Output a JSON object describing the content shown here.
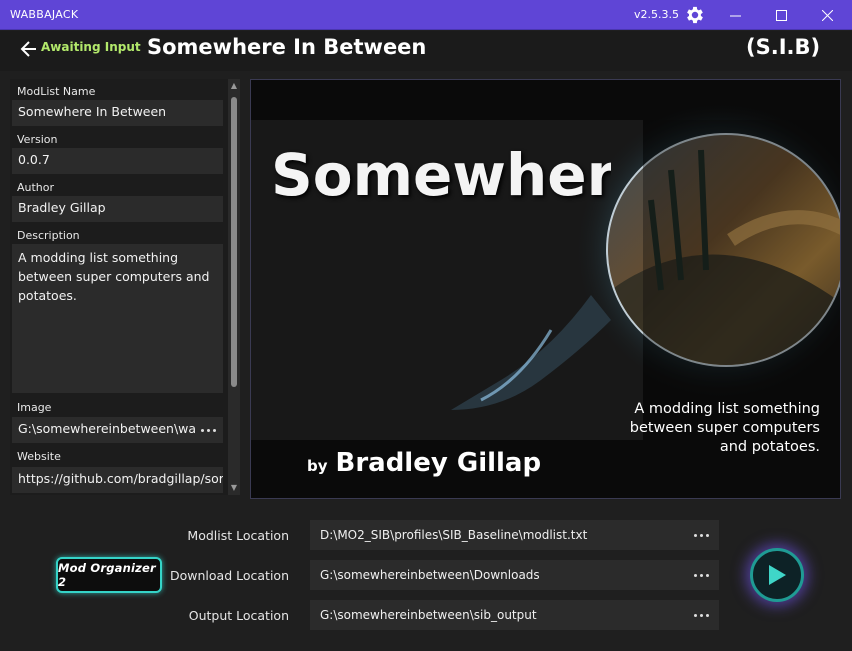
{
  "app": {
    "title": "WABBAJACK",
    "version": "v2.5.3.5"
  },
  "header": {
    "status": "Awaiting Input",
    "title": "Somewhere In Between",
    "short_name": "(S.I.B)"
  },
  "fields": {
    "name": {
      "label": "ModList Name",
      "value": "Somewhere In Between"
    },
    "version": {
      "label": "Version",
      "value": "0.0.7"
    },
    "author": {
      "label": "Author",
      "value": "Bradley Gillap"
    },
    "description": {
      "label": "Description",
      "value": "A modding list something between super computers and potatoes."
    },
    "image": {
      "label": "Image",
      "value": "G:\\somewhereinbetween\\wa"
    },
    "website": {
      "label": "Website",
      "value": "https://github.com/bradgillap/sor"
    }
  },
  "splash": {
    "title": "Somewhere In Between (S.I.B)",
    "by": "by",
    "author": "Bradley Gillap",
    "description": "A modding list something between super computers and potatoes."
  },
  "locations": {
    "modlist": {
      "label": "Modlist Location",
      "value": "D:\\MO2_SIB\\profiles\\SIB_Baseline\\modlist.txt"
    },
    "download": {
      "label": "Download Location",
      "value": "G:\\somewhereinbetween\\Downloads"
    },
    "output": {
      "label": "Output Location",
      "value": "G:\\somewhereinbetween\\sib_output"
    }
  },
  "logo": {
    "text": "Mod Organizer 2"
  },
  "icons": {
    "settings": "gear-icon",
    "back": "arrow-left-icon",
    "run": "play-icon",
    "browse": "ellipsis-icon"
  },
  "colors": {
    "titlebar": "#5f45d6",
    "status": "#b2e86b",
    "accent": "#1f9b94",
    "glow": "#7a5aff"
  }
}
